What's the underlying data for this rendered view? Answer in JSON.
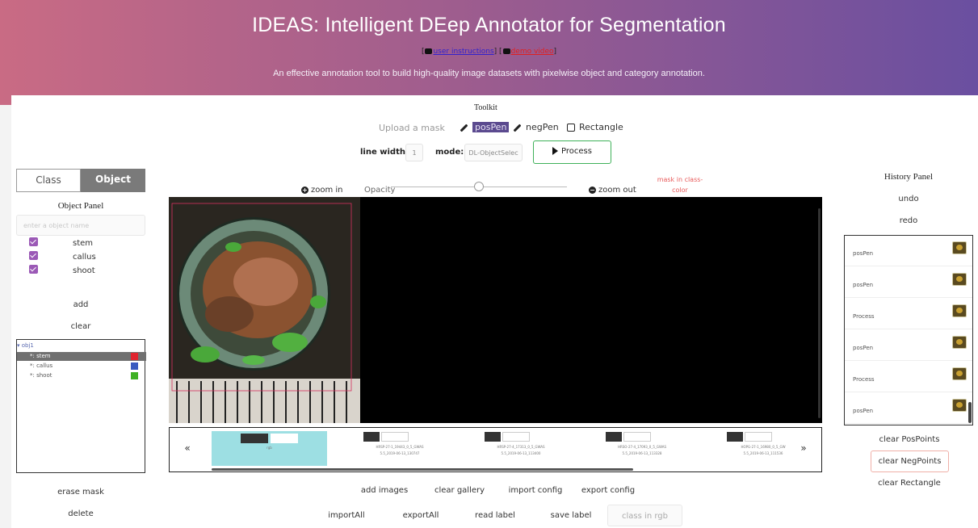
{
  "header": {
    "title": "IDEAS: Intelligent DEep Annotator for Segmentation",
    "link_open": "[",
    "link_sep": "] [",
    "link_close": "]",
    "link_instructions": "user instructions",
    "link_demo": "demo video",
    "subtitle": "An effective annotation tool to build high-quality image datasets with pixelwise object and category annotation."
  },
  "toolkit": {
    "title": "Toolkit",
    "upload": "Upload a mask",
    "pos_pen": "posPen",
    "neg_pen": "negPen",
    "rectangle": "Rectangle",
    "line_width_label": "line width:",
    "line_width_value": "1",
    "mode_label": "mode:",
    "mode_value": "DL-ObjectSelec",
    "process": "Process"
  },
  "left_panel": {
    "tab_class": "Class",
    "tab_object": "Object",
    "title": "Object Panel",
    "input_placeholder": "enter a object name",
    "categories": [
      {
        "label": "stem",
        "checked": true
      },
      {
        "label": "callus",
        "checked": true
      },
      {
        "label": "shoot",
        "checked": true
      }
    ],
    "add": "add",
    "clear": "clear",
    "tree": {
      "root": "▾ obj1",
      "items": [
        {
          "label": "*: stem",
          "color": "#e0242f",
          "selected": true
        },
        {
          "label": "*: callus",
          "color": "#3a5bc0",
          "selected": false
        },
        {
          "label": "*: shoot",
          "color": "#3fb124",
          "selected": false
        }
      ]
    },
    "erase_mask": "erase mask",
    "delete": "delete"
  },
  "canvas_bar": {
    "zoom_in": "zoom in",
    "zoom_in_icon": "+",
    "opacity": "Opacity",
    "opacity_value": 0.5,
    "zoom_out": "zoom out",
    "zoom_out_icon": "−",
    "mask_class_color": "mask in class-color"
  },
  "gallery": {
    "prev": "«",
    "next": "»",
    "selected_label": "rgb",
    "items": [
      {
        "line1": "HRSP-27-1_19443_0_5_GWAS",
        "line2": "5.5_2019-06-13_130747"
      },
      {
        "line1": "HRSP-27-4_17313_0_5_GWAS",
        "line2": "5.5_2019-06-13_113400"
      },
      {
        "line1": "HRSO-27-4_17093_0_5_GWAS",
        "line2": "5.5_2019-06-13_113328"
      },
      {
        "line1": "HOPG-27-1_16980_0_5_GW",
        "line2": "5.5_2019-06-13_111536"
      }
    ]
  },
  "bottom_buttons": {
    "add_images": "add images",
    "clear_gallery": "clear gallery",
    "import_config": "import config",
    "export_config": "export config",
    "import_all": "importAll",
    "export_all": "exportAll",
    "read_label": "read label",
    "save_label": "save label",
    "class_rgb_placeholder": "class in rgb"
  },
  "history": {
    "title": "History Panel",
    "undo": "undo",
    "redo": "redo",
    "entries": [
      "posPen",
      "posPen",
      "Process",
      "posPen",
      "Process",
      "posPen"
    ],
    "clear_pos": "clear PosPoints",
    "clear_neg": "clear NegPoints",
    "clear_rect": "clear Rectangle"
  },
  "colors": {
    "header_left": "#c96b84",
    "header_right": "#6a4fa0",
    "checkbox": "#9b59b6",
    "process_border": "#3fb15a",
    "gallery_selected": "#9ddfe3"
  }
}
